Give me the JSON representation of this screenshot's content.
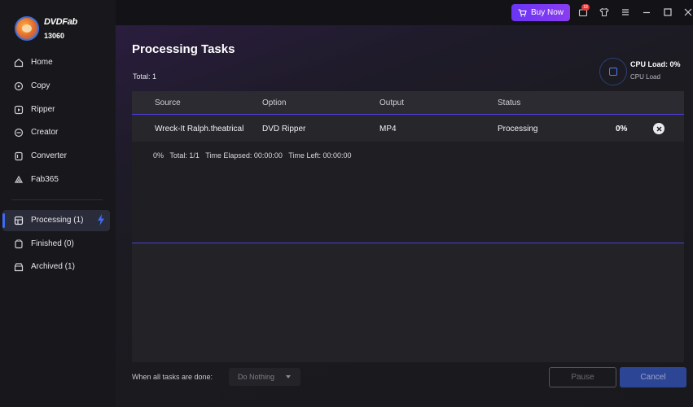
{
  "app": {
    "brand": "DVDFab",
    "user_id": "13060"
  },
  "sidebar": {
    "items": [
      {
        "label": "Home",
        "icon": "home-icon"
      },
      {
        "label": "Copy",
        "icon": "copy-icon"
      },
      {
        "label": "Ripper",
        "icon": "ripper-icon"
      },
      {
        "label": "Creator",
        "icon": "creator-icon"
      },
      {
        "label": "Converter",
        "icon": "converter-icon"
      },
      {
        "label": "Fab365",
        "icon": "fab365-icon"
      }
    ],
    "tasks": [
      {
        "label": "Processing (1)",
        "icon": "processing-icon",
        "active": true
      },
      {
        "label": "Finished (0)",
        "icon": "finished-icon",
        "active": false
      },
      {
        "label": "Archived (1)",
        "icon": "archived-icon",
        "active": false
      }
    ]
  },
  "topbar": {
    "buy_now": "Buy Now",
    "notification_count": "18",
    "icons": [
      "cart-icon",
      "notification-icon",
      "skin-icon",
      "menu-icon",
      "minimize-icon",
      "maximize-icon",
      "close-icon"
    ]
  },
  "main": {
    "title": "Processing Tasks",
    "total": "Total: 1",
    "cpu_load_value": "CPU Load: 0%",
    "cpu_load_label": "CPU Load"
  },
  "table": {
    "columns": [
      "Source",
      "Option",
      "Output",
      "Status"
    ],
    "rows": [
      {
        "source": "Wreck-It Ralph.theatrical",
        "option": "DVD Ripper",
        "output": "MP4",
        "status": "Processing",
        "percent": "0%"
      }
    ],
    "detail": "0%   Total: 1/1   Time Elapsed: 00:00:00   Time Left: 00:00:00"
  },
  "footer": {
    "when_done_label": "When all tasks are done:",
    "when_done_value": "Do Nothing",
    "pause": "Pause",
    "cancel": "Cancel"
  },
  "colors": {
    "accent": "#3d6cf2",
    "purple": "#6a35f5",
    "row_divider": "#4b3ed6",
    "cancel_bg": "#2d4595"
  }
}
